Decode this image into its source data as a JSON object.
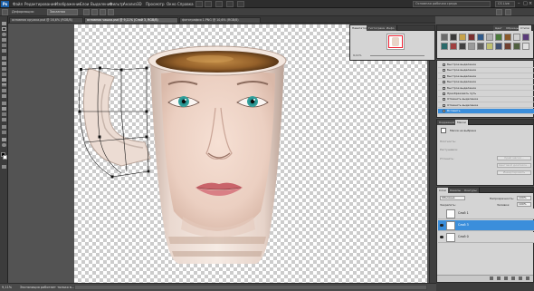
{
  "menu": {
    "app_badge": "Ps",
    "items": [
      "Файл",
      "Редактирование",
      "Изображение",
      "Слои",
      "Выделение",
      "Фильтр",
      "Анализ",
      "3D",
      "Просмотр",
      "Окно",
      "Справка"
    ],
    "workspace_label": "Основная рабочая среда",
    "cs_live_label": "CS Live"
  },
  "options": {
    "preset_label": "Деформация:",
    "preset_value": "Заказная"
  },
  "tabs": [
    {
      "label": "основная кружка.psd @ 16,6% (RGB/8)"
    },
    {
      "label": "основная чашка.psd @ 9,11% (Слой 3, RGB/8)"
    },
    {
      "label": "фотография 1.PNG @ 10,6% (RGB/8)"
    }
  ],
  "status": {
    "zoom": "9,11%",
    "doc_info": "Экспозиция работает только в..."
  },
  "navigator": {
    "tabs": [
      "Навигатор",
      "Гистограмма",
      "Инфо"
    ],
    "zoom": "9,11%"
  },
  "styles": {
    "tabs": [
      "Цвет",
      "Образцы",
      "Стили"
    ],
    "swatch_colors": [
      "#6b6b6b",
      "#3a3a3a",
      "#c8a34a",
      "#7a2f2f",
      "#2f5a8a",
      "#b0b0b0",
      "#4a7a3a",
      "#8a5a2a",
      "#d0d0d0",
      "#5a3a7a",
      "#2a6a6a",
      "#a04040",
      "#3f3f3f",
      "#9a9a9a",
      "#606060",
      "#c0c070",
      "#405070",
      "#704030",
      "#506040",
      "#e0e0e0"
    ]
  },
  "history": {
    "rows": [
      {
        "label": "Быстрое выделение"
      },
      {
        "label": "Быстрое выделение"
      },
      {
        "label": "Быстрое выделение"
      },
      {
        "label": "Быстрое выделение"
      },
      {
        "label": "Быстрое выделение"
      },
      {
        "label": "Преобразовать путь"
      },
      {
        "label": "Отменить выделение"
      },
      {
        "label": "Отменить выделение"
      },
      {
        "label": "Вставить"
      }
    ]
  },
  "masks": {
    "tabs": [
      "Коррекция",
      "Маски"
    ],
    "title": "Маска не выбрана",
    "labels": [
      "Плотность:",
      "Растушевка:",
      "Уточнить:"
    ],
    "buttons": [
      "Край маски...",
      "Цветовой диапазон...",
      "Инвертировать"
    ]
  },
  "layers": {
    "tabs": [
      "Слои",
      "Каналы",
      "Контуры"
    ],
    "blend_mode": "Обычные",
    "opacity_label": "Непрозрачность:",
    "opacity_value": "100%",
    "lock_label": "Закрепить:",
    "fill_label": "Заливка:",
    "fill_value": "100%",
    "items": [
      {
        "name": "Слой 1",
        "visible": false,
        "active": false
      },
      {
        "name": "Слой 3",
        "visible": true,
        "active": true
      },
      {
        "name": "Слой 0",
        "visible": true,
        "active": false
      }
    ]
  }
}
